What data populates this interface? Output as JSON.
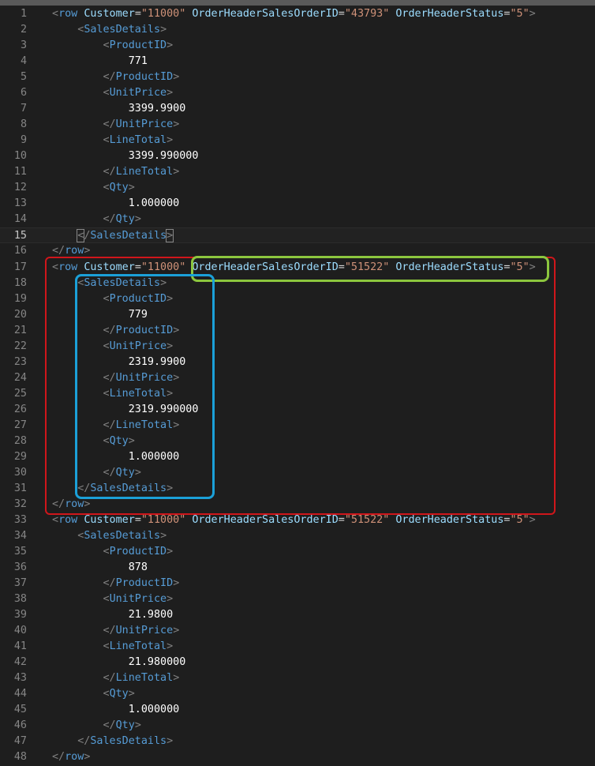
{
  "colors": {
    "annotation_red": "#d0161b",
    "annotation_green": "#8cc63e",
    "annotation_blue": "#1ba0d8"
  },
  "current_line": 15,
  "lines": [
    [
      [
        "p",
        "<"
      ],
      [
        "t",
        "row "
      ],
      [
        "a",
        "Customer"
      ],
      [
        "e",
        "="
      ],
      [
        "s",
        "\"11000\""
      ],
      [
        "a",
        " OrderHeaderSalesOrderID"
      ],
      [
        "e",
        "="
      ],
      [
        "s",
        "\"43793\""
      ],
      [
        "a",
        " OrderHeaderStatus"
      ],
      [
        "e",
        "="
      ],
      [
        "s",
        "\"5\""
      ],
      [
        "p",
        ">"
      ]
    ],
    [
      [
        "i",
        "1"
      ],
      [
        "p",
        "<"
      ],
      [
        "t",
        "SalesDetails"
      ],
      [
        "p",
        ">"
      ]
    ],
    [
      [
        "i",
        "2"
      ],
      [
        "p",
        "<"
      ],
      [
        "t",
        "ProductID"
      ],
      [
        "p",
        ">"
      ]
    ],
    [
      [
        "i",
        "3"
      ],
      [
        "x",
        "771"
      ]
    ],
    [
      [
        "i",
        "2"
      ],
      [
        "p",
        "</"
      ],
      [
        "t",
        "ProductID"
      ],
      [
        "p",
        ">"
      ]
    ],
    [
      [
        "i",
        "2"
      ],
      [
        "p",
        "<"
      ],
      [
        "t",
        "UnitPrice"
      ],
      [
        "p",
        ">"
      ]
    ],
    [
      [
        "i",
        "3"
      ],
      [
        "x",
        "3399.9900"
      ]
    ],
    [
      [
        "i",
        "2"
      ],
      [
        "p",
        "</"
      ],
      [
        "t",
        "UnitPrice"
      ],
      [
        "p",
        ">"
      ]
    ],
    [
      [
        "i",
        "2"
      ],
      [
        "p",
        "<"
      ],
      [
        "t",
        "LineTotal"
      ],
      [
        "p",
        ">"
      ]
    ],
    [
      [
        "i",
        "3"
      ],
      [
        "x",
        "3399.990000"
      ]
    ],
    [
      [
        "i",
        "2"
      ],
      [
        "p",
        "</"
      ],
      [
        "t",
        "LineTotal"
      ],
      [
        "p",
        ">"
      ]
    ],
    [
      [
        "i",
        "2"
      ],
      [
        "p",
        "<"
      ],
      [
        "t",
        "Qty"
      ],
      [
        "p",
        ">"
      ]
    ],
    [
      [
        "i",
        "3"
      ],
      [
        "x",
        "1.000000"
      ]
    ],
    [
      [
        "i",
        "2"
      ],
      [
        "p",
        "</"
      ],
      [
        "t",
        "Qty"
      ],
      [
        "p",
        ">"
      ]
    ],
    [
      [
        "i",
        "1"
      ],
      [
        "pb",
        "<"
      ],
      [
        "p",
        "/"
      ],
      [
        "t",
        "SalesDetails"
      ],
      [
        "pb",
        ">"
      ]
    ],
    [
      [
        "p",
        "</"
      ],
      [
        "t",
        "row"
      ],
      [
        "p",
        ">"
      ]
    ],
    [
      [
        "p",
        "<"
      ],
      [
        "t",
        "row "
      ],
      [
        "a",
        "Customer"
      ],
      [
        "e",
        "="
      ],
      [
        "s",
        "\"11000\""
      ],
      [
        "a",
        " OrderHeaderSalesOrderID"
      ],
      [
        "e",
        "="
      ],
      [
        "s",
        "\"51522\""
      ],
      [
        "a",
        " OrderHeaderStatus"
      ],
      [
        "e",
        "="
      ],
      [
        "s",
        "\"5\""
      ],
      [
        "p",
        ">"
      ]
    ],
    [
      [
        "i",
        "1"
      ],
      [
        "p",
        "<"
      ],
      [
        "t",
        "SalesDetails"
      ],
      [
        "p",
        ">"
      ]
    ],
    [
      [
        "i",
        "2"
      ],
      [
        "p",
        "<"
      ],
      [
        "t",
        "ProductID"
      ],
      [
        "p",
        ">"
      ]
    ],
    [
      [
        "i",
        "3"
      ],
      [
        "x",
        "779"
      ]
    ],
    [
      [
        "i",
        "2"
      ],
      [
        "p",
        "</"
      ],
      [
        "t",
        "ProductID"
      ],
      [
        "p",
        ">"
      ]
    ],
    [
      [
        "i",
        "2"
      ],
      [
        "p",
        "<"
      ],
      [
        "t",
        "UnitPrice"
      ],
      [
        "p",
        ">"
      ]
    ],
    [
      [
        "i",
        "3"
      ],
      [
        "x",
        "2319.9900"
      ]
    ],
    [
      [
        "i",
        "2"
      ],
      [
        "p",
        "</"
      ],
      [
        "t",
        "UnitPrice"
      ],
      [
        "p",
        ">"
      ]
    ],
    [
      [
        "i",
        "2"
      ],
      [
        "p",
        "<"
      ],
      [
        "t",
        "LineTotal"
      ],
      [
        "p",
        ">"
      ]
    ],
    [
      [
        "i",
        "3"
      ],
      [
        "x",
        "2319.990000"
      ]
    ],
    [
      [
        "i",
        "2"
      ],
      [
        "p",
        "</"
      ],
      [
        "t",
        "LineTotal"
      ],
      [
        "p",
        ">"
      ]
    ],
    [
      [
        "i",
        "2"
      ],
      [
        "p",
        "<"
      ],
      [
        "t",
        "Qty"
      ],
      [
        "p",
        ">"
      ]
    ],
    [
      [
        "i",
        "3"
      ],
      [
        "x",
        "1.000000"
      ]
    ],
    [
      [
        "i",
        "2"
      ],
      [
        "p",
        "</"
      ],
      [
        "t",
        "Qty"
      ],
      [
        "p",
        ">"
      ]
    ],
    [
      [
        "i",
        "1"
      ],
      [
        "p",
        "</"
      ],
      [
        "t",
        "SalesDetails"
      ],
      [
        "p",
        ">"
      ]
    ],
    [
      [
        "p",
        "</"
      ],
      [
        "t",
        "row"
      ],
      [
        "p",
        ">"
      ]
    ],
    [
      [
        "p",
        "<"
      ],
      [
        "t",
        "row "
      ],
      [
        "a",
        "Customer"
      ],
      [
        "e",
        "="
      ],
      [
        "s",
        "\"11000\""
      ],
      [
        "a",
        " OrderHeaderSalesOrderID"
      ],
      [
        "e",
        "="
      ],
      [
        "s",
        "\"51522\""
      ],
      [
        "a",
        " OrderHeaderStatus"
      ],
      [
        "e",
        "="
      ],
      [
        "s",
        "\"5\""
      ],
      [
        "p",
        ">"
      ]
    ],
    [
      [
        "i",
        "1"
      ],
      [
        "p",
        "<"
      ],
      [
        "t",
        "SalesDetails"
      ],
      [
        "p",
        ">"
      ]
    ],
    [
      [
        "i",
        "2"
      ],
      [
        "p",
        "<"
      ],
      [
        "t",
        "ProductID"
      ],
      [
        "p",
        ">"
      ]
    ],
    [
      [
        "i",
        "3"
      ],
      [
        "x",
        "878"
      ]
    ],
    [
      [
        "i",
        "2"
      ],
      [
        "p",
        "</"
      ],
      [
        "t",
        "ProductID"
      ],
      [
        "p",
        ">"
      ]
    ],
    [
      [
        "i",
        "2"
      ],
      [
        "p",
        "<"
      ],
      [
        "t",
        "UnitPrice"
      ],
      [
        "p",
        ">"
      ]
    ],
    [
      [
        "i",
        "3"
      ],
      [
        "x",
        "21.9800"
      ]
    ],
    [
      [
        "i",
        "2"
      ],
      [
        "p",
        "</"
      ],
      [
        "t",
        "UnitPrice"
      ],
      [
        "p",
        ">"
      ]
    ],
    [
      [
        "i",
        "2"
      ],
      [
        "p",
        "<"
      ],
      [
        "t",
        "LineTotal"
      ],
      [
        "p",
        ">"
      ]
    ],
    [
      [
        "i",
        "3"
      ],
      [
        "x",
        "21.980000"
      ]
    ],
    [
      [
        "i",
        "2"
      ],
      [
        "p",
        "</"
      ],
      [
        "t",
        "LineTotal"
      ],
      [
        "p",
        ">"
      ]
    ],
    [
      [
        "i",
        "2"
      ],
      [
        "p",
        "<"
      ],
      [
        "t",
        "Qty"
      ],
      [
        "p",
        ">"
      ]
    ],
    [
      [
        "i",
        "3"
      ],
      [
        "x",
        "1.000000"
      ]
    ],
    [
      [
        "i",
        "2"
      ],
      [
        "p",
        "</"
      ],
      [
        "t",
        "Qty"
      ],
      [
        "p",
        ">"
      ]
    ],
    [
      [
        "i",
        "1"
      ],
      [
        "p",
        "</"
      ],
      [
        "t",
        "SalesDetails"
      ],
      [
        "p",
        ">"
      ]
    ],
    [
      [
        "p",
        "</"
      ],
      [
        "t",
        "row"
      ],
      [
        "p",
        ">"
      ]
    ]
  ]
}
